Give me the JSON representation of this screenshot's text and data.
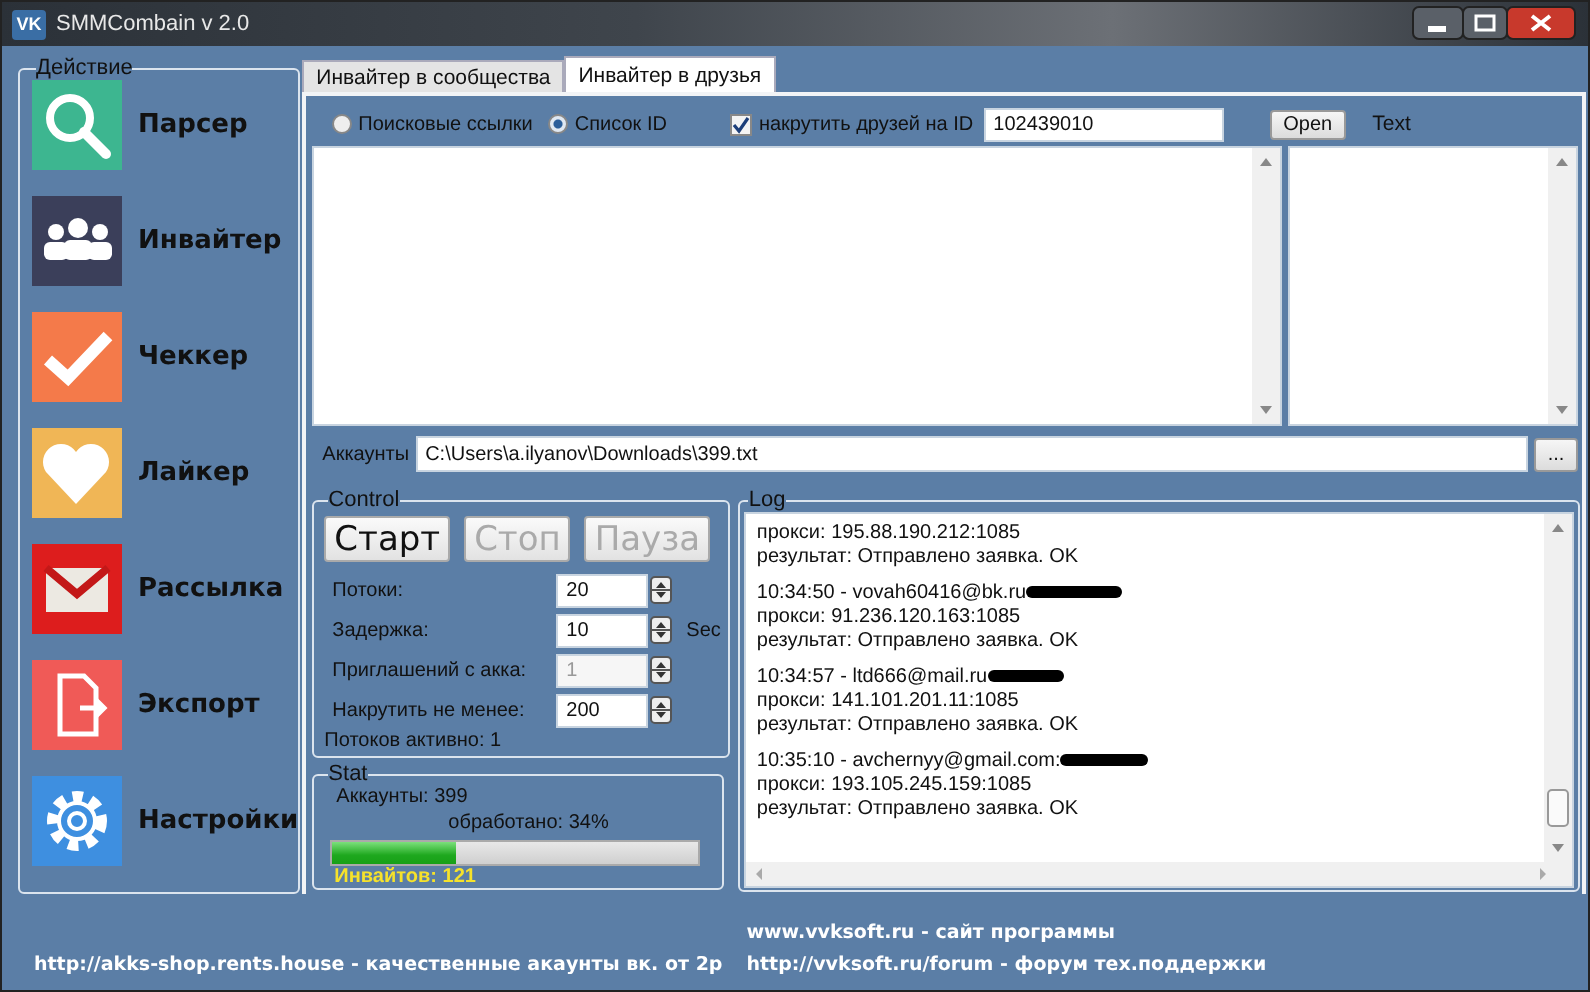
{
  "window": {
    "title": "SMMCombain v 2.0",
    "logo": "VK"
  },
  "sidebar": {
    "legend": "Действие",
    "items": [
      {
        "label": "Парсер",
        "kind": "search"
      },
      {
        "label": "Инвайтер",
        "kind": "people"
      },
      {
        "label": "Чеккер",
        "kind": "check"
      },
      {
        "label": "Лайкер",
        "kind": "heart"
      },
      {
        "label": "Рассылка",
        "kind": "mail"
      },
      {
        "label": "Экспорт",
        "kind": "export"
      },
      {
        "label": "Настройки",
        "kind": "settings"
      }
    ]
  },
  "tabs": [
    {
      "label": "Инвайтер в сообщества",
      "selected": false
    },
    {
      "label": "Инвайтер в друзья",
      "selected": true
    }
  ],
  "source_options": [
    {
      "label": "Поисковые ссылки",
      "selected": false
    },
    {
      "label": "Список ID",
      "selected": true
    }
  ],
  "friends_checkbox": {
    "label": "накрутить друзей на ID",
    "checked": true
  },
  "id_field": {
    "value": "102439010"
  },
  "open_button": "Open",
  "text_label": "Text",
  "accounts": {
    "label": "Аккаунты",
    "value": "C:\\Users\\a.ilyanov\\Downloads\\399.txt",
    "browse_button": "..."
  },
  "control": {
    "legend": "Control",
    "buttons": [
      {
        "label": "Старт",
        "disabled": false
      },
      {
        "label": "Стоп",
        "disabled": true
      },
      {
        "label": "Пауза",
        "disabled": true
      }
    ],
    "fields": [
      {
        "label": "Потоки:",
        "value": "20",
        "disabled": false
      },
      {
        "label": "Задержка:",
        "value": "10",
        "disabled": false,
        "unit": "Sec"
      },
      {
        "label": "Приглашений с акка:",
        "value": "1",
        "disabled": true
      },
      {
        "label": "Накрутить не менее:",
        "value": "200",
        "disabled": false
      }
    ],
    "active_threads": "Потоков активно: 1"
  },
  "stat": {
    "legend": "Stat",
    "accounts": "Аккаунты: 399",
    "processed": "обработано: 34%",
    "progress": {
      "level": 0.34
    },
    "invites": "Инвайтов: 121"
  },
  "log": {
    "legend": "Log",
    "entries": [
      {
        "lines": [
          "прокси: 195.88.190.212:1085",
          "результат: Отправлено заявка. OK"
        ]
      },
      {
        "header": "10:34:50 - vovah60416@bk.ru",
        "redacted": true,
        "lines": [
          "прокси: 91.236.120.163:1085",
          "результат: Отправлено заявка. OK"
        ]
      },
      {
        "header": "10:34:57 - ltd666@mail.ru",
        "redacted": true,
        "lines": [
          "прокси: 141.101.201.11:1085",
          "результат: Отправлено заявка. OK"
        ]
      },
      {
        "header": "10:35:10 - avchernyy@gmail.com:",
        "redacted": true,
        "lines": [
          "прокси: 193.105.245.159:1085",
          "результат: Отправлено заявка. OK"
        ]
      }
    ]
  },
  "footer": {
    "left": "http://akks-shop.rents.house - качественные акаунты вк. от 2р",
    "right": [
      "www.vvksoft.ru - сайт программы",
      "http://vvksoft.ru/forum - форум тех.поддержки"
    ]
  }
}
